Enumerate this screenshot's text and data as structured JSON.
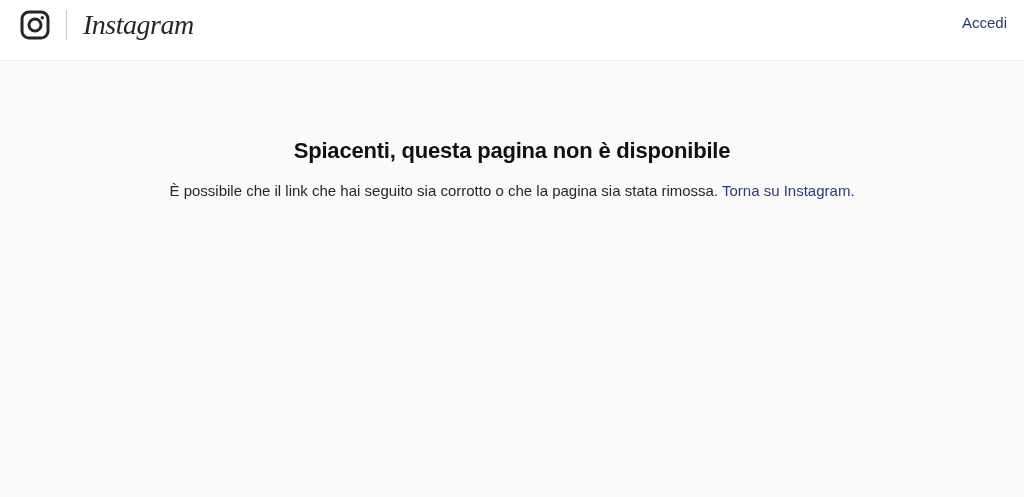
{
  "header": {
    "wordmark": "Instagram",
    "login_link": "Accedi"
  },
  "error": {
    "title": "Spiacenti, questa pagina non è disponibile",
    "message": "È possibile che il link che hai seguito sia corrotto o che la pagina sia stata rimossa.",
    "link": "Torna su Instagram."
  }
}
